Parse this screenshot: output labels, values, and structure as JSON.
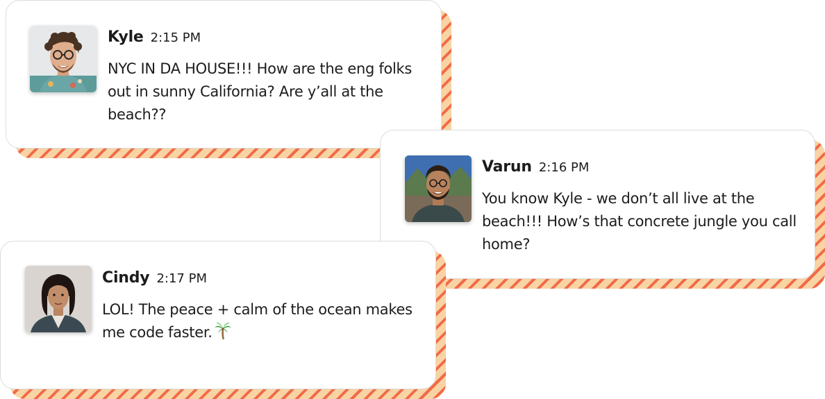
{
  "messages": [
    {
      "name": "Kyle",
      "time": "2:15 PM",
      "text": "NYC IN DA HOUSE!!! How are the eng folks out in sunny California? Are y’all at the beach??"
    },
    {
      "name": "Varun",
      "time": "2:16 PM",
      "text": "You know Kyle - we don’t all live at the beach!!! How’s that concrete jungle you call home?"
    },
    {
      "name": "Cindy",
      "time": "2:17 PM",
      "text": "LOL! The peace + calm of the ocean makes me code faster."
    }
  ],
  "colors": {
    "stripe_light": "#f8d3a4",
    "stripe_dark": "#f26a47",
    "text": "#1d1c1d",
    "border": "#dcdcdc"
  },
  "icons": {
    "emoji": "palm-tree-icon"
  }
}
